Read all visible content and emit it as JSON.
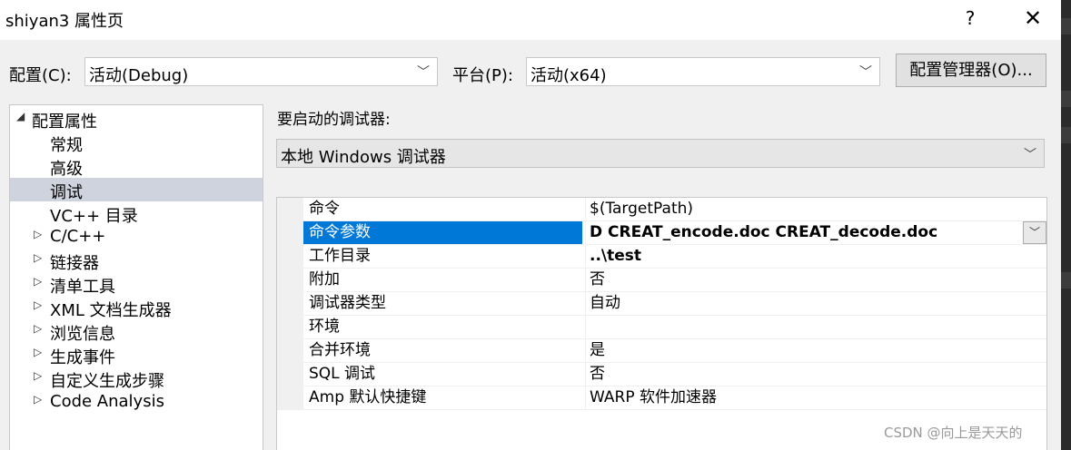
{
  "window": {
    "title": "shiyan3 属性页",
    "help_glyph": "?",
    "close_glyph": "✕"
  },
  "config": {
    "label": "配置(C):",
    "value": "活动(Debug)",
    "platform_label": "平台(P):",
    "platform_value": "活动(x64)",
    "manager_button": "配置管理器(O)..."
  },
  "tree": {
    "items": [
      {
        "label": "配置属性",
        "expander": "◢"
      },
      {
        "label": "常规",
        "expander": ""
      },
      {
        "label": "高级",
        "expander": ""
      },
      {
        "label": "调试",
        "expander": ""
      },
      {
        "label": "VC++ 目录",
        "expander": ""
      },
      {
        "label": "C/C++",
        "expander": "▷"
      },
      {
        "label": "链接器",
        "expander": "▷"
      },
      {
        "label": "清单工具",
        "expander": "▷"
      },
      {
        "label": "XML 文档生成器",
        "expander": "▷"
      },
      {
        "label": "浏览信息",
        "expander": "▷"
      },
      {
        "label": "生成事件",
        "expander": "▷"
      },
      {
        "label": "自定义生成步骤",
        "expander": "▷"
      },
      {
        "label": "Code Analysis",
        "expander": "▷"
      }
    ],
    "selected": "调试"
  },
  "debugger": {
    "label": "要启动的调试器:",
    "value": "本地 Windows 调试器"
  },
  "properties": [
    {
      "name": "命令",
      "value": "$(TargetPath)"
    },
    {
      "name": "命令参数",
      "value": "D CREAT_encode.doc CREAT_decode.doc"
    },
    {
      "name": "工作目录",
      "value": "..\\test"
    },
    {
      "name": "附加",
      "value": "否"
    },
    {
      "name": "调试器类型",
      "value": "自动"
    },
    {
      "name": "环境",
      "value": ""
    },
    {
      "name": "合并环境",
      "value": "是"
    },
    {
      "name": "SQL 调试",
      "value": "否"
    },
    {
      "name": "Amp 默认快捷键",
      "value": "WARP 软件加速器"
    }
  ],
  "watermark": "CSDN @向上是天天的"
}
